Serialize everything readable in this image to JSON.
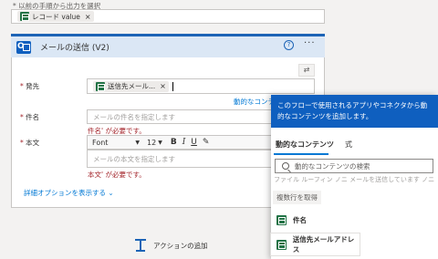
{
  "previous": {
    "label": "* 以前の手順から出力を選択",
    "chip": "レコード value",
    "chip_close": "×"
  },
  "card": {
    "title": "メールの送信 (V2)",
    "help": "?",
    "more": "···",
    "to_label": "発先",
    "to_chip": "送信先メール...",
    "to_chip_close": "×",
    "dynamic_link": "動的なコンテンツ",
    "subject_label": "件名",
    "subject_placeholder": "メールの件名を指定します",
    "subject_error": "件名' が必要です。",
    "body_label": "本文",
    "font_name": "Font",
    "font_size": "12",
    "bold": "B",
    "italic": "I",
    "underline": "U",
    "pen": "✎",
    "body_placeholder": "メールの本文を指定します",
    "body_error": "本文' が必要です。",
    "advanced_link": "詳細オプションを表示する",
    "swap": "⇄"
  },
  "add_action": "アクションの追加",
  "popup": {
    "header": "このフローで使用されるアプリやコネクタから動的なコンテンツを追加します。",
    "tab_dynamic": "動的なコンテンツ",
    "tab_expression": "式",
    "search_placeholder": "動的なコンテンツの検索",
    "hidden_text": "ファイル ルーフィン ノニ メールを送信しています ノニ ヒュ",
    "multi_button": "複数行を取得",
    "items": [
      "件名",
      "送信先メールアドレス"
    ]
  },
  "colors": {
    "accent": "#0f5fbf",
    "error": "#a4262c",
    "link": "#0078d4",
    "excel": "#217346"
  }
}
